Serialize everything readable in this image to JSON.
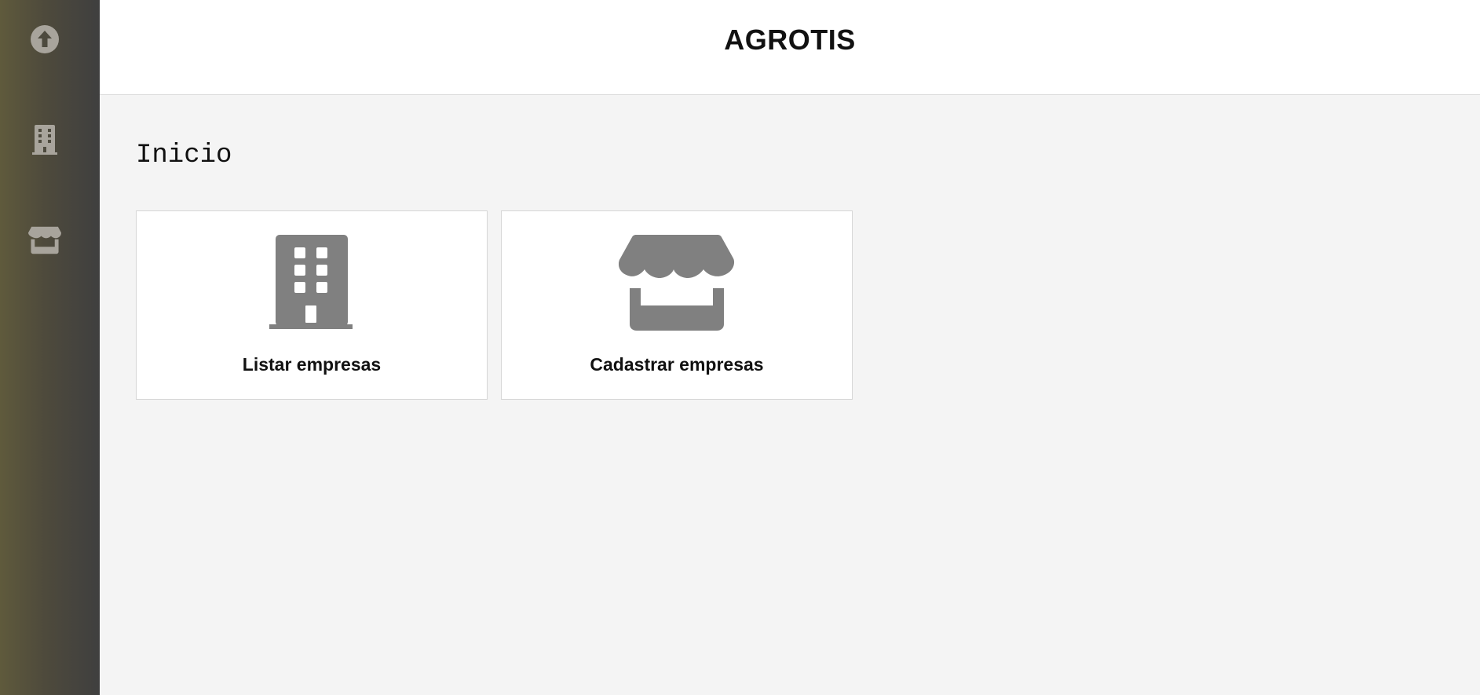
{
  "app": {
    "title": "AGROTIS"
  },
  "sidebar": {
    "items": [
      {
        "icon": "arrow-up-circle-icon"
      },
      {
        "icon": "building-icon"
      },
      {
        "icon": "store-icon"
      }
    ],
    "icon_color": "#a8a49c"
  },
  "main": {
    "page_title": "Inicio",
    "cards": [
      {
        "label": "Listar empresas",
        "icon": "building-icon"
      },
      {
        "label": "Cadastrar empresas",
        "icon": "store-icon"
      }
    ],
    "icon_color": "#808080"
  }
}
